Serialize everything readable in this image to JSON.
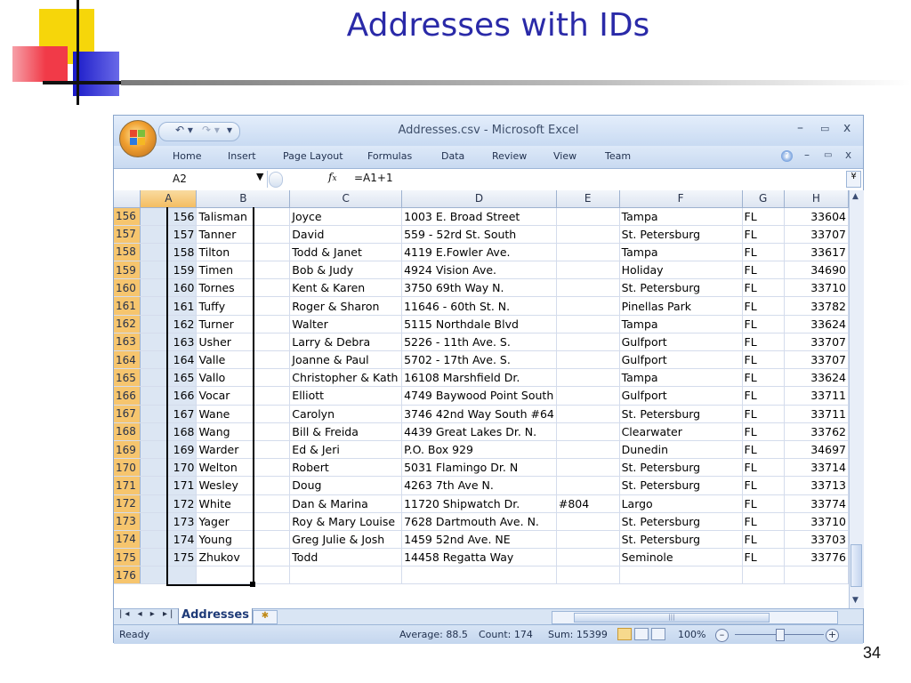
{
  "slide": {
    "title": "Addresses with IDs",
    "page_number": "34"
  },
  "window": {
    "title": "Addresses.csv - Microsoft Excel",
    "controls": {
      "minimize": "–",
      "restore": "▭",
      "close": "x"
    },
    "doc_controls": {
      "minimize": "–",
      "restore": "▭",
      "close": "x"
    }
  },
  "ribbon": {
    "tabs": [
      "Home",
      "Insert",
      "Page Layout",
      "Formulas",
      "Data",
      "Review",
      "View",
      "Team"
    ]
  },
  "formula_bar": {
    "name_box": "A2",
    "fx": "fx",
    "formula": "=A1+1"
  },
  "columns": [
    "A",
    "B",
    "C",
    "D",
    "E",
    "F",
    "G",
    "H"
  ],
  "rows": [
    {
      "n": "156",
      "a": "156",
      "b": "Talisman",
      "c": "Joyce",
      "d": "1003 E. Broad Street",
      "e": "",
      "f": "Tampa",
      "g": "FL",
      "h": "33604"
    },
    {
      "n": "157",
      "a": "157",
      "b": "Tanner",
      "c": "David",
      "d": "559 - 52rd St. South",
      "e": "",
      "f": "St. Petersburg",
      "g": "FL",
      "h": "33707"
    },
    {
      "n": "158",
      "a": "158",
      "b": "Tilton",
      "c": "Todd & Janet",
      "d": "4119 E.Fowler Ave.",
      "e": "",
      "f": "Tampa",
      "g": "FL",
      "h": "33617"
    },
    {
      "n": "159",
      "a": "159",
      "b": "Timen",
      "c": "Bob & Judy",
      "d": "4924 Vision Ave.",
      "e": "",
      "f": "Holiday",
      "g": "FL",
      "h": "34690"
    },
    {
      "n": "160",
      "a": "160",
      "b": "Tornes",
      "c": "Kent & Karen",
      "d": "3750 69th Way N.",
      "e": "",
      "f": "St. Petersburg",
      "g": "FL",
      "h": "33710"
    },
    {
      "n": "161",
      "a": "161",
      "b": "Tuffy",
      "c": "Roger & Sharon",
      "d": "11646 - 60th St. N.",
      "e": "",
      "f": "Pinellas Park",
      "g": "FL",
      "h": "33782"
    },
    {
      "n": "162",
      "a": "162",
      "b": "Turner",
      "c": "Walter",
      "d": "5115 Northdale Blvd",
      "e": "",
      "f": "Tampa",
      "g": "FL",
      "h": "33624"
    },
    {
      "n": "163",
      "a": "163",
      "b": "Usher",
      "c": "Larry & Debra",
      "d": "5226 - 11th Ave. S.",
      "e": "",
      "f": "Gulfport",
      "g": "FL",
      "h": "33707"
    },
    {
      "n": "164",
      "a": "164",
      "b": "Valle",
      "c": "Joanne & Paul",
      "d": "5702 - 17th Ave. S.",
      "e": "",
      "f": "Gulfport",
      "g": "FL",
      "h": "33707"
    },
    {
      "n": "165",
      "a": "165",
      "b": "Vallo",
      "c": "Christopher & Kath",
      "d": "16108 Marshfield Dr.",
      "e": "",
      "f": "Tampa",
      "g": "FL",
      "h": "33624"
    },
    {
      "n": "166",
      "a": "166",
      "b": "Vocar",
      "c": "Elliott",
      "d": "4749 Baywood Point South",
      "e": "",
      "f": "Gulfport",
      "g": "FL",
      "h": "33711"
    },
    {
      "n": "167",
      "a": "167",
      "b": "Wane",
      "c": "Carolyn",
      "d": "3746 42nd Way  South #64",
      "e": "",
      "f": "St. Petersburg",
      "g": "FL",
      "h": "33711"
    },
    {
      "n": "168",
      "a": "168",
      "b": "Wang",
      "c": "Bill & Freida",
      "d": "4439 Great Lakes Dr. N.",
      "e": "",
      "f": "Clearwater",
      "g": "FL",
      "h": "33762"
    },
    {
      "n": "169",
      "a": "169",
      "b": "Warder",
      "c": "Ed & Jeri",
      "d": "P.O. Box 929",
      "e": "",
      "f": "Dunedin",
      "g": "FL",
      "h": "34697"
    },
    {
      "n": "170",
      "a": "170",
      "b": "Welton",
      "c": "Robert",
      "d": "5031 Flamingo Dr. N",
      "e": "",
      "f": "St. Petersburg",
      "g": "FL",
      "h": "33714"
    },
    {
      "n": "171",
      "a": "171",
      "b": "Wesley",
      "c": "Doug",
      "d": "4263 7th Ave N.",
      "e": "",
      "f": "St. Petersburg",
      "g": "FL",
      "h": "33713"
    },
    {
      "n": "172",
      "a": "172",
      "b": "White",
      "c": "Dan & Marina",
      "d": "11720 Shipwatch Dr.",
      "e": "#804",
      "f": "Largo",
      "g": "FL",
      "h": "33774"
    },
    {
      "n": "173",
      "a": "173",
      "b": "Yager",
      "c": "Roy & Mary Louise",
      "d": "7628 Dartmouth Ave. N.",
      "e": "",
      "f": "St. Petersburg",
      "g": "FL",
      "h": "33710"
    },
    {
      "n": "174",
      "a": "174",
      "b": "Young",
      "c": "Greg Julie & Josh",
      "d": "1459  52nd Ave. NE",
      "e": "",
      "f": "St. Petersburg",
      "g": "FL",
      "h": "33703"
    },
    {
      "n": "175",
      "a": "175",
      "b": "Zhukov",
      "c": "Todd",
      "d": "14458 Regatta Way",
      "e": "",
      "f": "Seminole",
      "g": "FL",
      "h": "33776"
    },
    {
      "n": "176",
      "a": "",
      "b": "",
      "c": "",
      "d": "",
      "e": "",
      "f": "",
      "g": "",
      "h": ""
    }
  ],
  "sheet_tabs": {
    "active": "Addresses"
  },
  "status_bar": {
    "mode": "Ready",
    "average": "Average: 88.5",
    "count": "Count: 174",
    "sum": "Sum: 15399",
    "zoom": "100%"
  },
  "colors": {
    "accent_title": "#2a2aa8",
    "row_header_selected": "#f6c56e",
    "excel_chrome": "#c9daf0"
  }
}
